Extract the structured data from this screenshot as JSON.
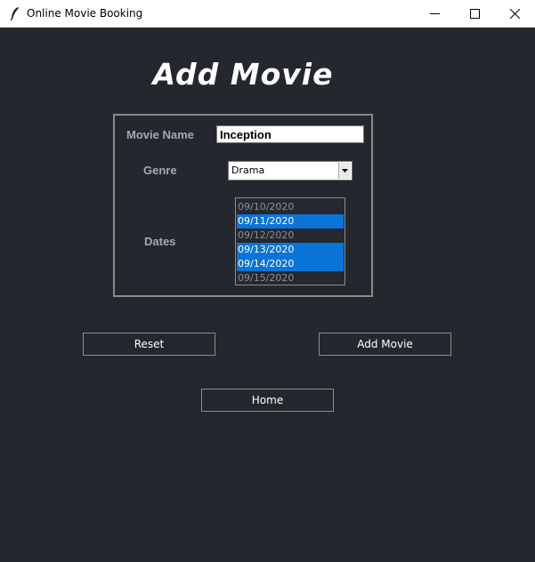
{
  "window": {
    "title": "Online Movie Booking",
    "app_icon": "feather-icon",
    "controls": [
      "minimize-icon",
      "maximize-icon",
      "close-icon"
    ]
  },
  "page": {
    "heading": "Add Movie"
  },
  "form": {
    "movie_name_label": "Movie Name",
    "movie_name_value": "Inception",
    "genre_label": "Genre",
    "genre_value": "Drama",
    "dates_label": "Dates",
    "dates": [
      {
        "date": "09/10/2020",
        "selected": false
      },
      {
        "date": "09/11/2020",
        "selected": true
      },
      {
        "date": "09/12/2020",
        "selected": false
      },
      {
        "date": "09/13/2020",
        "selected": true
      },
      {
        "date": "09/14/2020",
        "selected": true
      },
      {
        "date": "09/15/2020",
        "selected": false
      }
    ]
  },
  "buttons": {
    "reset_label": "Reset",
    "add_movie_label": "Add Movie",
    "home_label": "Home"
  },
  "colors": {
    "background": "#24272d",
    "selection": "#0a74d9",
    "label": "#a3a8b2"
  }
}
